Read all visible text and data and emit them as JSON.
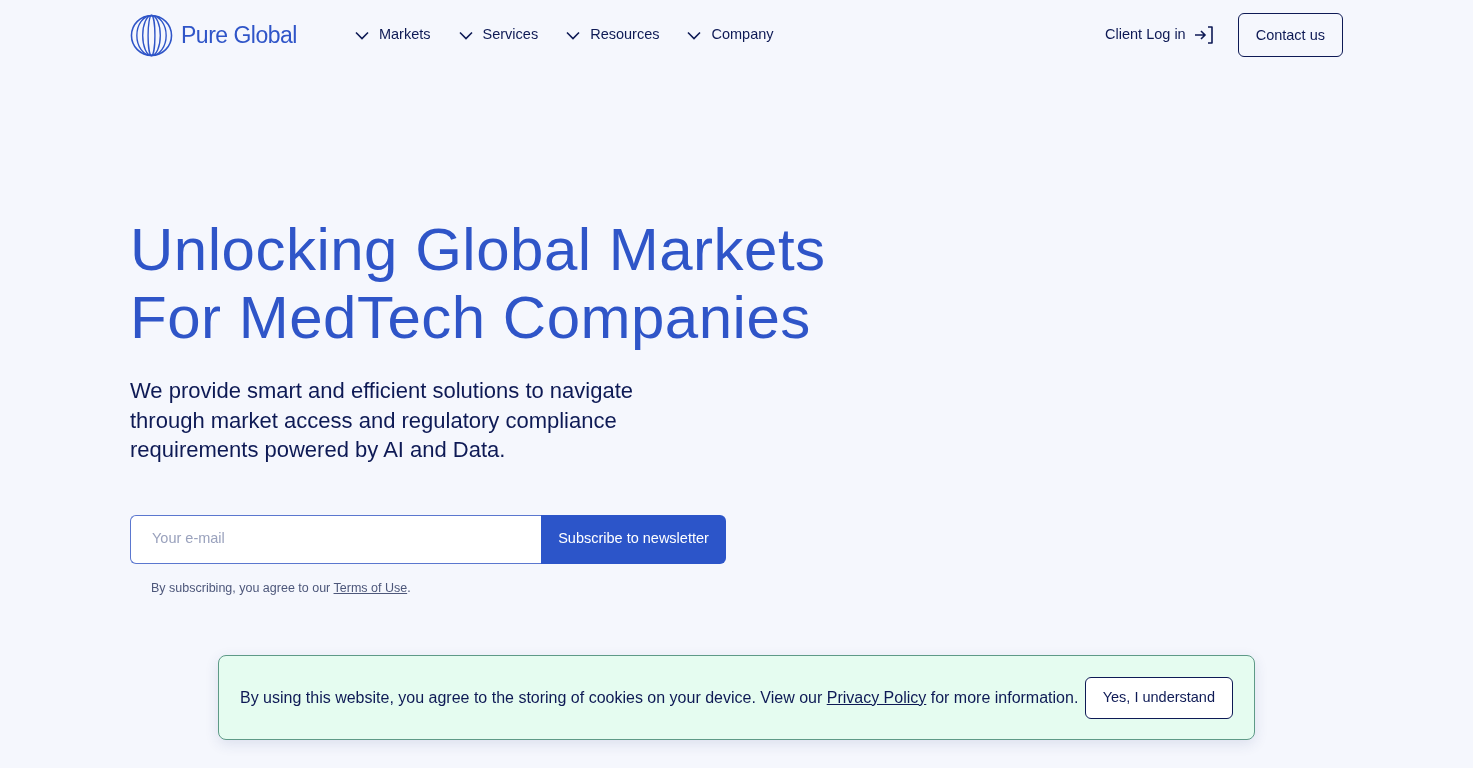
{
  "nav": {
    "logo": "Pure Global",
    "menu": [
      {
        "label": "Markets"
      },
      {
        "label": "Services"
      },
      {
        "label": "Resources"
      },
      {
        "label": "Company"
      }
    ],
    "login": "Client Log in",
    "contact": "Contact us"
  },
  "hero": {
    "title_lines": [
      "Unlocking Global Markets",
      "For MedTech Companies"
    ],
    "lead": "We provide smart and efficient solutions to navigate through market access and regulatory compliance requirements powered by AI and Data.",
    "newsletter": {
      "placeholder": "Your e-mail",
      "button": "Subscribe to newsletter",
      "note_before": "By subscribing, you agree to our ",
      "note_link": "Terms of Use",
      "note_after": "."
    }
  },
  "cookie_banner": {
    "text_before": "By using this website, you agree to the storing of cookies on your device. View our ",
    "link": "Privacy Policy",
    "text_after": " for more information.",
    "button": "Yes, I understand"
  }
}
